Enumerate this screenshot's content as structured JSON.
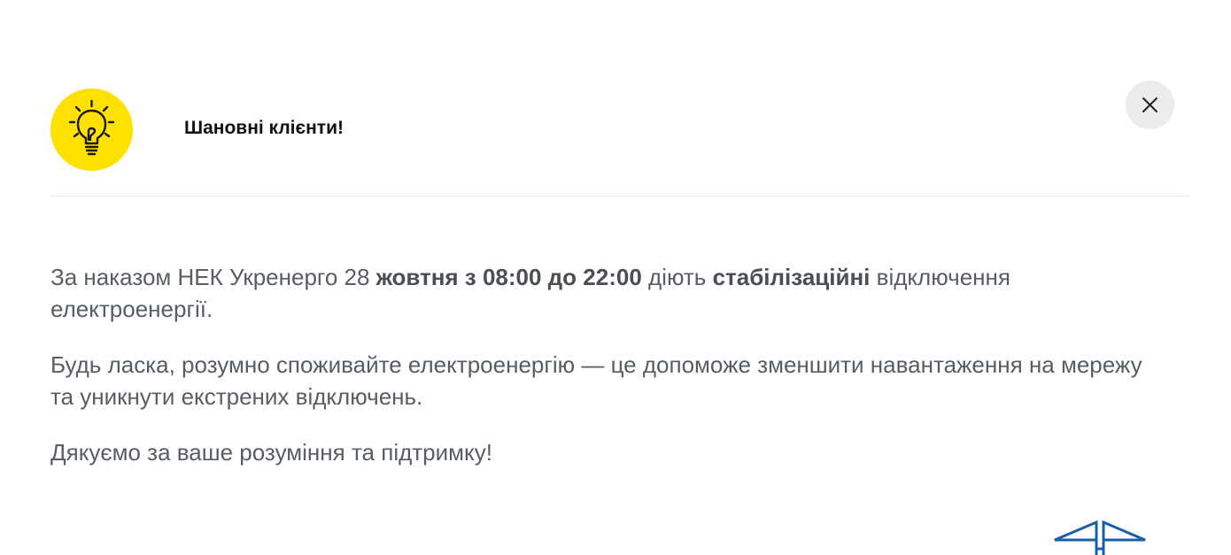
{
  "modal": {
    "title": "Шановні клієнти!",
    "badge_icon": "lightbulb-icon",
    "badge_color": "#ffe100",
    "close_icon": "close-icon"
  },
  "message": {
    "paragraph1": {
      "part1": "За наказом НЕК Укренерго 28 ",
      "part2_bold": "жовтня з 08:00 до 22:00",
      "part3": " діють ",
      "part4_bold": "стабілізаційні",
      "part5": " відключення електроенергії."
    },
    "paragraph2": "Будь ласка, розумно споживайте електроенергію — це допоможе зменшити навантаження на мережу та уникнути екстрених відключень.",
    "paragraph3": "Дякуємо за ваше розуміння та підтримку!"
  },
  "footer": {
    "logo_icon": "power-tower-logo-icon",
    "logo_color": "#1a5fa8"
  }
}
